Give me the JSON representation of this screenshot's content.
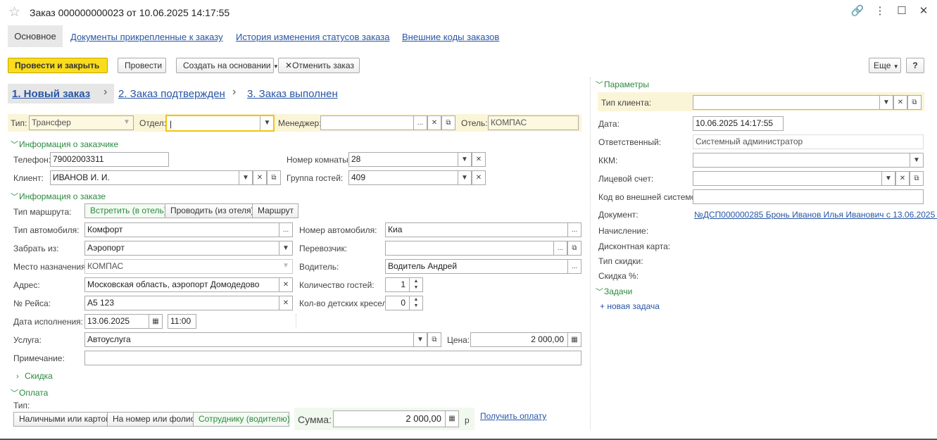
{
  "window": {
    "title": "Заказ 000000000023 от 10.06.2025 14:17:55",
    "link_icon": "🔗",
    "more_icon": "⋮",
    "max_icon": "☐",
    "close_icon": "✕",
    "star_icon": "☆"
  },
  "tabs": {
    "main": "Основное",
    "docs": "Документы прикрепленные к заказу",
    "history": "История изменения статусов заказа",
    "codes": "Внешние коды заказов"
  },
  "toolbar": {
    "post_close": "Провести и закрыть",
    "post": "Провести",
    "create_based": "Создать на основании",
    "cancel": "Отменить заказ",
    "more": "Еще",
    "help": "?"
  },
  "steps": {
    "s1": "1. Новый заказ",
    "s2": "2. Заказ подтвержден",
    "s3": "3. Заказ выполнен"
  },
  "header": {
    "type_label": "Тип:",
    "type_value": "Трансфер",
    "dept_label": "Отдел:",
    "dept_value": "",
    "manager_label": "Менеджер:",
    "manager_value": "",
    "hotel_label": "Отель:",
    "hotel_value": "КОМПАС"
  },
  "customer": {
    "section": "Информация о заказчике",
    "phone_label": "Телефон:",
    "phone_value": "79002003311",
    "room_label": "Номер комнаты:",
    "room_value": "28",
    "client_label": "Клиент:",
    "client_value": "ИВАНОВ И. И.",
    "group_label": "Группа гостей:",
    "group_value": "409"
  },
  "order": {
    "section": "Информация о заказе",
    "route_label": "Тип маршрута:",
    "route_options": [
      "Встретить (в отель)",
      "Проводить (из отеля)",
      "Маршрут"
    ],
    "car_type_label": "Тип автомобиля:",
    "car_type_value": "Комфорт",
    "car_num_label": "Номер автомобиля:",
    "car_num_value": "Киа",
    "pickup_label": "Забрать из:",
    "pickup_value": "Аэропорт",
    "carrier_label": "Перевозчик:",
    "carrier_value": "",
    "dest_label": "Место назначения:",
    "dest_value": "КОМПАС",
    "driver_label": "Водитель:",
    "driver_value": "Водитель Андрей",
    "address_label": "Адрес:",
    "address_value": "Московская область, аэропорт Домодедово",
    "guests_label": "Количество гостей:",
    "guests_value": "1",
    "flight_label": "№ Рейса:",
    "flight_value": "А5 123",
    "kids_label": "Кол-во детских кресел:",
    "kids_value": "0",
    "date_label": "Дата исполнения:",
    "date_value": "13.06.2025",
    "time_value": "11:00",
    "service_label": "Услуга:",
    "service_value": "Автоуслуга",
    "price_label": "Цена:",
    "price_value": "2 000,00",
    "note_label": "Примечание:",
    "note_value": "",
    "discount_section": "Скидка"
  },
  "payment": {
    "section": "Оплата",
    "type_label": "Тип:",
    "options": [
      "Наличными или картой",
      "На номер или фолио",
      "Сотруднику (водителю)"
    ],
    "sum_label": "Сумма:",
    "sum_value": "2 000,00",
    "currency": "р",
    "get_payment": "Получить оплату"
  },
  "params": {
    "section": "Параметры",
    "client_type_label": "Тип клиента:",
    "client_type_value": "",
    "date_label": "Дата:",
    "date_value": "10.06.2025 14:17:55",
    "resp_label": "Ответственный:",
    "resp_value": "Системный администратор",
    "kkm_label": "ККМ:",
    "kkm_value": "",
    "account_label": "Лицевой счет:",
    "account_value": "",
    "ext_code_label": "Код во внешней системе:",
    "ext_code_value": "",
    "doc_label": "Документ:",
    "doc_value": "№ДСП000000285 Бронь Иванов Илья Иванович с 13.06.2025 ...",
    "accrual_label": "Начисление:",
    "card_label": "Дисконтная карта:",
    "discount_type_label": "Тип скидки:",
    "discount_pct_label": "Скидка %:"
  },
  "tasks": {
    "section": "Задачи",
    "new_task": "+ новая задача"
  }
}
